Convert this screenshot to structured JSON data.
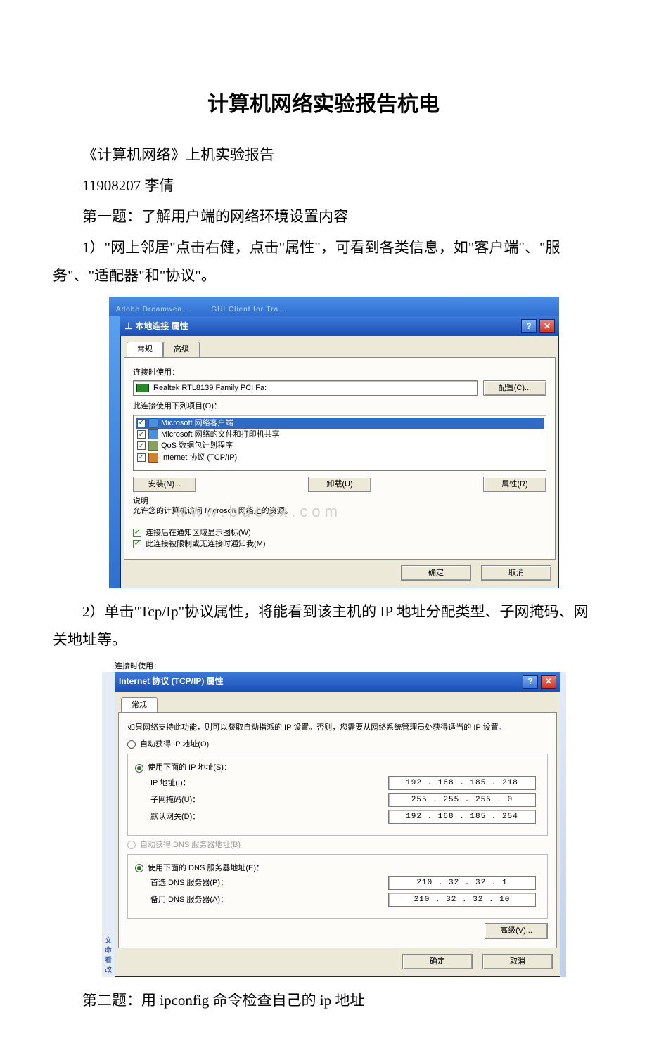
{
  "title": "计算机网络实验报告杭电",
  "intro": {
    "line1": "《计算机网络》上机实验报告",
    "line2": "11908207 李倩",
    "q1_heading": "第一题：了解用户端的网络环境设置内容",
    "q1_step1": "1）\"网上邻居\"点击右健，点击\"属性\"，可看到各类信息，如\"客户端\"、\"服务\"、\"适配器\"和\"协议\"。",
    "q1_step2": "2）单击\"Tcp/Ip\"协议属性，将能看到该主机的 IP 地址分配类型、子网掩码、网关地址等。",
    "q2_heading": "第二题：用 ipconfig 命令检查自己的 ip 地址"
  },
  "fig1": {
    "topstub1": "Adobe Dreamwea...",
    "topstub2": "GUI Client for Tra...",
    "title": "本地连接 属性",
    "tab_general": "常规",
    "tab_advanced": "高级",
    "lbl_conn": "连接时使用：",
    "adapter": "Realtek RTL8139 Family PCI Fa:",
    "btn_config": "配置(C)...",
    "lbl_items": "此连接使用下列项目(O)：",
    "items": [
      "Microsoft 网络客户端",
      "Microsoft 网络的文件和打印机共享",
      "QoS 数据包计划程序",
      "Internet 协议 (TCP/IP)"
    ],
    "btn_install": "安装(N)...",
    "btn_uninstall": "卸载(U)",
    "btn_props": "属性(R)",
    "desc_label": "说明",
    "desc_text": "允许您的计算机访问 Microsoft 网络上的资源。",
    "watermark": "www.bdocx.com",
    "chk1": "连接后在通知区域显示图标(W)",
    "chk2": "此连接被限制或无连接时通知我(M)",
    "btn_ok": "确定",
    "btn_cancel": "取消"
  },
  "fig2": {
    "pre": "连接时使用：",
    "title": "Internet 协议 (TCP/IP) 属性",
    "tab_general": "常规",
    "hint": "如果网络支持此功能，则可以获取自动指派的 IP 设置。否则，您需要从网络系统管理员处获得适当的 IP 设置。",
    "r_auto_ip": "自动获得 IP 地址(O)",
    "r_use_ip": "使用下面的 IP 地址(S)：",
    "lbl_ip": "IP 地址(I)：",
    "lbl_mask": "子网掩码(U)：",
    "lbl_gw": "默认网关(D)：",
    "ip": "192 . 168 . 185 . 218",
    "mask": "255 . 255 . 255 .  0",
    "gw": "192 . 168 . 185 . 254",
    "r_auto_dns": "自动获得 DNS 服务器地址(B)",
    "r_use_dns": "使用下面的 DNS 服务器地址(E)：",
    "lbl_dns1": "首选 DNS 服务器(P)：",
    "lbl_dns2": "备用 DNS 服务器(A)：",
    "dns1": "210 .  32 .  32 .  1",
    "dns2": "210 .  32 .  32 . 10",
    "btn_adv": "高级(V)...",
    "btn_ok": "确定",
    "btn_cancel": "取消",
    "leftchars": [
      "文",
      "命",
      "看",
      "改"
    ]
  }
}
